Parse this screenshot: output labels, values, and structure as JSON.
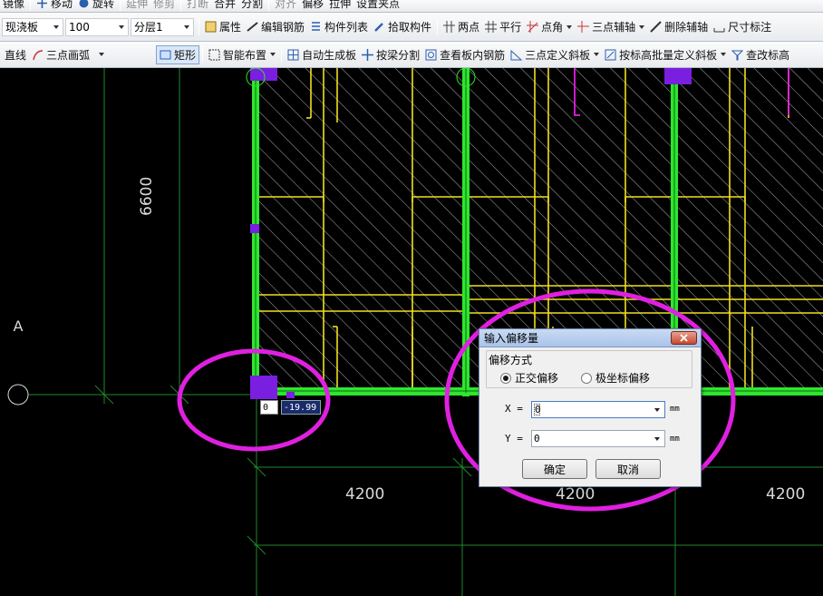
{
  "toolbar0": {
    "items": [
      "镜像",
      "移动",
      "旋转",
      "延伸",
      "修剪",
      "打断",
      "合并",
      "分割",
      "对齐",
      "偏移",
      "拉伸",
      "设置夹点"
    ]
  },
  "toolbar1": {
    "component_type": "现浇板",
    "component_name": "100",
    "layer": "分层1",
    "properties": "属性",
    "edit_rebar": "编辑钢筋",
    "component_list": "构件列表",
    "pick_component": "拾取构件",
    "two_points": "两点",
    "parallel": "平行",
    "point_angle": "点角",
    "three_point_axis": "三点辅轴",
    "delete_axis": "删除辅轴",
    "dimension": "尺寸标注"
  },
  "toolbar2": {
    "line": "直线",
    "three_point_arc": "三点画弧",
    "rectangle": "矩形",
    "smart_layout": "智能布置",
    "auto_generate_slab": "自动生成板",
    "split_by_beam": "按梁分割",
    "view_slab_rebar": "查看板内钢筋",
    "three_point_slope": "三点定义斜板",
    "batch_slope_by_elevation": "按标高批量定义斜板",
    "modify_elevation": "查改标高"
  },
  "canvas": {
    "dim_vertical": "6600",
    "dim_h1": "4200",
    "dim_h2": "4200",
    "dim_h3": "4200",
    "axis_label": "A",
    "coord_input_1": "0",
    "coord_input_2": "-19.99"
  },
  "dialog": {
    "title": "输入偏移量",
    "group_label": "偏移方式",
    "radio_orthogonal": "正交偏移",
    "radio_polar": "极坐标偏移",
    "x_label": "X =",
    "x_value": "0",
    "y_label": "Y =",
    "y_value": "0",
    "unit_x": "mm",
    "unit_y": "mm",
    "ok": "确定",
    "cancel": "取消"
  },
  "colors": {
    "green_beam": "#2ee62e",
    "yellow_rebar": "#f0e020",
    "magenta_annotation": "#e020e0",
    "purple_column": "#7a1ee0",
    "grid_line": "#1e8a2a"
  }
}
